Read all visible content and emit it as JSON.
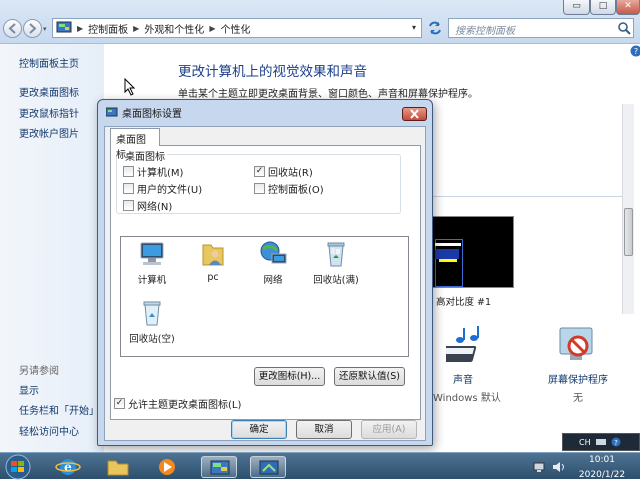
{
  "window": {
    "breadcrumb": [
      "控制面板",
      "外观和个性化",
      "个性化"
    ],
    "search_placeholder": "搜索控制面板",
    "title_buttons": {
      "minimize": "▭",
      "maximize": "□",
      "close": "✕"
    }
  },
  "sidebar": {
    "home": "控制面板主页",
    "links": [
      "更改桌面图标",
      "更改鼠标指针",
      "更改帐户图片"
    ],
    "see_also_heading": "另请参阅",
    "see_also": [
      "显示",
      "任务栏和「开始」",
      "轻松访问中心"
    ]
  },
  "main": {
    "title": "更改计算机上的视觉效果和声音",
    "subtitle": "单击某个主题立即更改桌面背景、窗口颜色、声音和屏幕保护程序。",
    "theme_label": "高对比度 #1",
    "sound_label": "声音",
    "sound_value": "Windows 默认",
    "saver_label": "屏幕保护程序",
    "saver_value": "无"
  },
  "dialog": {
    "title": "桌面图标设置",
    "tab": "桌面图标",
    "group_label": "桌面图标",
    "checkboxes": [
      {
        "label": "计算机(M)",
        "checked": false
      },
      {
        "label": "回收站(R)",
        "checked": true
      },
      {
        "label": "用户的文件(U)",
        "checked": false
      },
      {
        "label": "控制面板(O)",
        "checked": false
      },
      {
        "label": "网络(N)",
        "checked": false
      }
    ],
    "icons": [
      {
        "label": "计算机",
        "icon": "computer-icon"
      },
      {
        "label": "pc",
        "icon": "user-folder-icon"
      },
      {
        "label": "网络",
        "icon": "network-icon"
      },
      {
        "label": "回收站(满)",
        "icon": "recycle-bin-full-icon"
      },
      {
        "label": "回收站(空)",
        "icon": "recycle-bin-empty-icon"
      }
    ],
    "change_icon_button": "更改图标(H)...",
    "restore_default_button": "还原默认值(S)",
    "allow_themes_label": "允许主题更改桌面图标(L)",
    "allow_themes_checked": true,
    "ok_button": "确定",
    "cancel_button": "取消",
    "apply_button": "应用(A)"
  },
  "ime": {
    "lang": "CH"
  },
  "taskbar": {
    "time": "10:01",
    "date": "2020/1/22"
  },
  "colors": {
    "accent": "#1b3f8a",
    "link": "#12386b",
    "taskbar": "#2c4f6e"
  }
}
